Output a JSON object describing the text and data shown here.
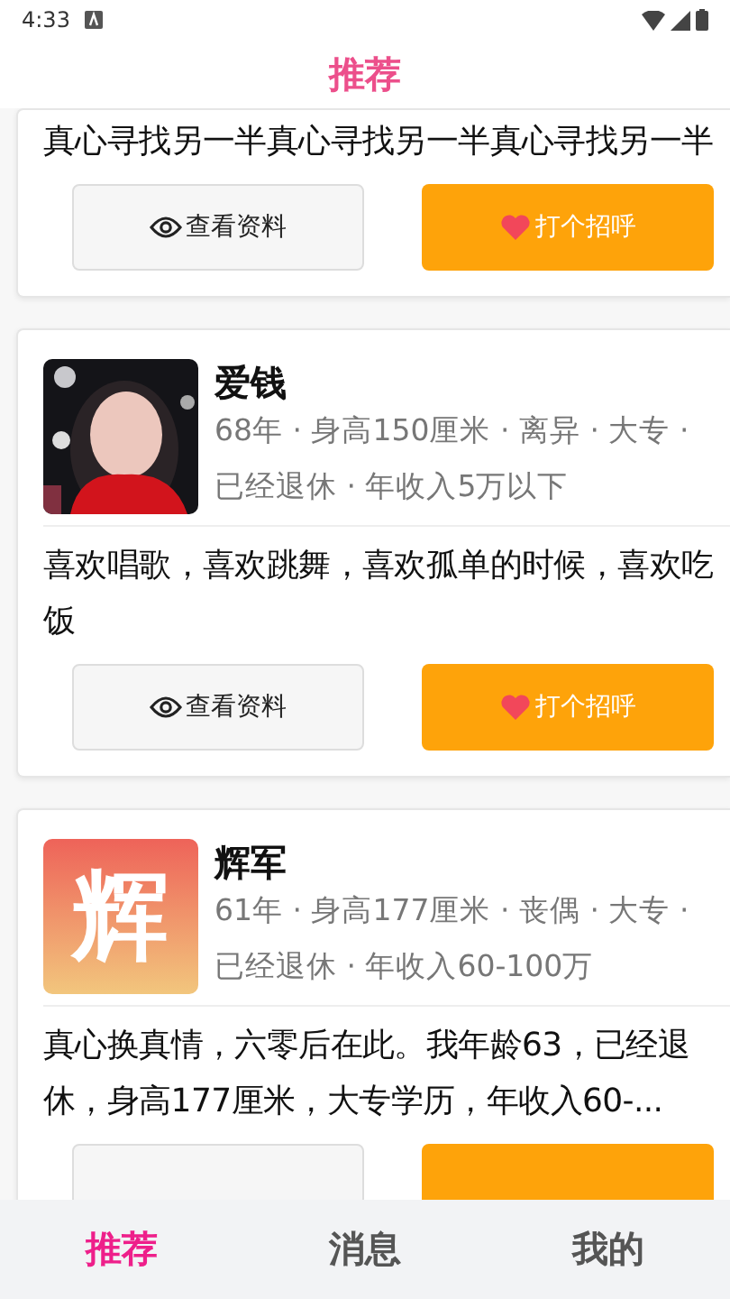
{
  "status_bar": {
    "time": "4:33"
  },
  "header": {
    "title": "推荐"
  },
  "cards": [
    {
      "bio": "真心寻找另一半真心寻找另一半真心寻找另一半",
      "buttons": [
        {
          "kind": "view",
          "label": "查看资料"
        },
        {
          "kind": "greet",
          "label": "打个招呼"
        }
      ]
    },
    {
      "name": "爱钱",
      "details": "68年 · 身高150厘米 · 离异 · 大专 · 已经退休 · 年收入5万以下",
      "avatar": {
        "kind": "picture"
      },
      "bio": "喜欢唱歌，喜欢跳舞，喜欢孤单的时候，喜欢吃饭",
      "buttons": [
        {
          "kind": "view",
          "label": "查看资料"
        },
        {
          "kind": "greet",
          "label": "打个招呼"
        }
      ]
    },
    {
      "name": "辉军",
      "details": "61年 · 身高177厘米 · 丧偶 · 大专 · 已经退休 · 年收入60-100万",
      "avatar": {
        "kind": "letter",
        "text": "辉"
      },
      "bio": "真心换真情，六零后在此。我年龄63，已经退休，身高177厘米，大专学历，年收入60-...",
      "buttons": [
        {
          "kind": "view"
        },
        {
          "kind": "greet"
        }
      ]
    }
  ],
  "tabs": [
    {
      "label": "推荐",
      "selected": true
    },
    {
      "label": "消息",
      "selected": false
    },
    {
      "label": "我的",
      "selected": false
    }
  ]
}
